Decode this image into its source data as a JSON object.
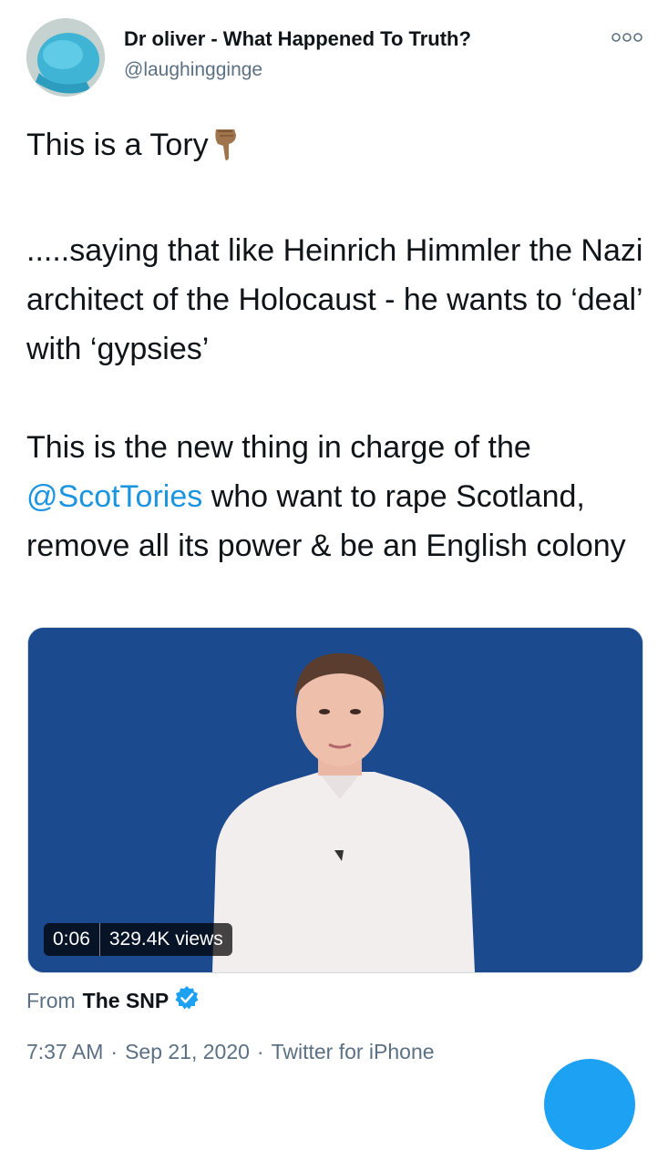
{
  "author": {
    "display_name": "Dr oliver - What Happened To Truth?",
    "handle": "@laughingginge"
  },
  "icons": {
    "avatar": "avatar-photo",
    "more": "more-options-icon",
    "pointer": "backhand-index-pointing-down-emoji",
    "verified": "verified-badge-icon",
    "compose": "compose-fab"
  },
  "tweet": {
    "line1_text": "This is a Tory",
    "line2": ".....saying that like Heinrich Himmler the Nazi architect of the Holocaust - he wants to ‘deal’ with ‘gypsies’",
    "line3_pre": "This is the new thing in charge of the ",
    "mention": "@ScotTories",
    "line3_post": " who want to rape Scotland, remove all its power & be an English colony"
  },
  "video": {
    "duration": "0:06",
    "views": "329.4K views"
  },
  "source": {
    "prefix": "From",
    "account": "The SNP"
  },
  "meta": {
    "time": "7:37 AM",
    "separator": "·",
    "date": "Sep 21, 2020",
    "client": "Twitter for iPhone"
  },
  "colors": {
    "link": "#1b95e0",
    "secondary": "#5b7083",
    "video_bg": "#1c4a8e",
    "fab": "#1da1f2"
  }
}
